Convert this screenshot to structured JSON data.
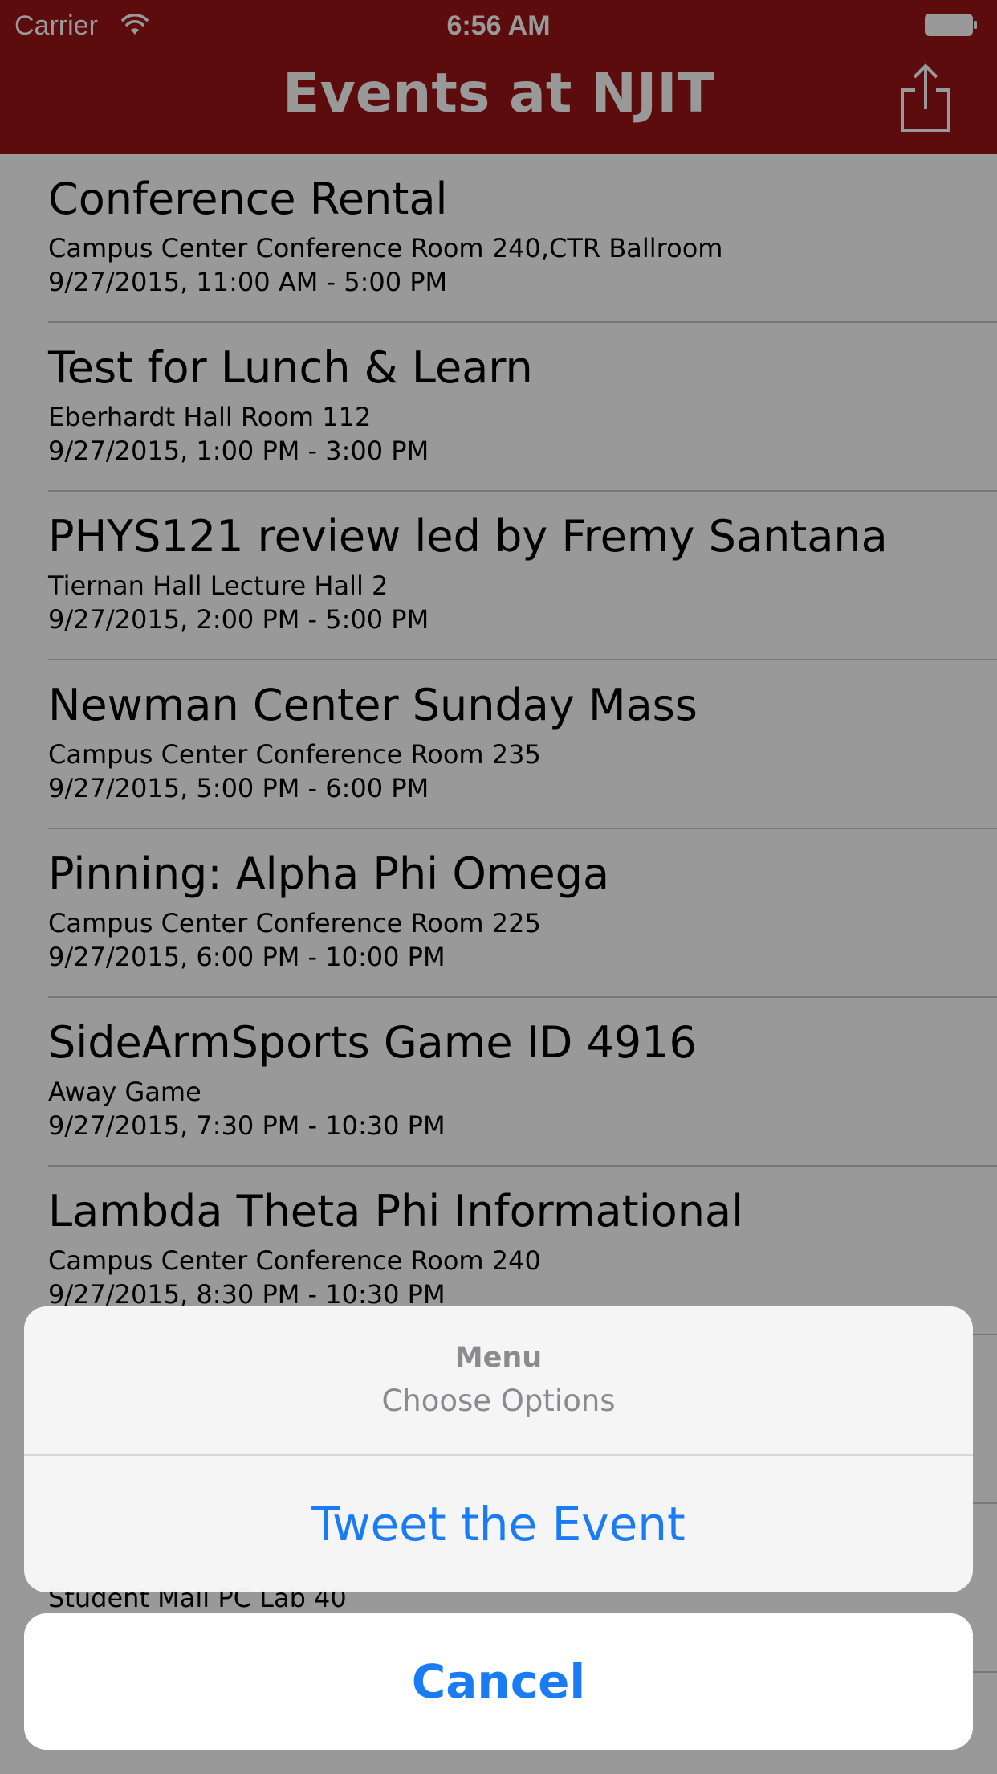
{
  "status_bar": {
    "carrier": "Carrier",
    "time": "6:56 AM"
  },
  "nav": {
    "title": "Events at NJIT",
    "share_icon": "share-icon"
  },
  "events": [
    {
      "title": "Conference Rental",
      "location": "Campus Center Conference Room 240,CTR Ballroom",
      "time": "9/27/2015, 11:00 AM - 5:00 PM"
    },
    {
      "title": "Test for Lunch & Learn",
      "location": "Eberhardt Hall Room 112",
      "time": "9/27/2015, 1:00 PM - 3:00 PM"
    },
    {
      "title": "PHYS121 review led by Fremy Santana",
      "location": "Tiernan Hall Lecture Hall 2",
      "time": "9/27/2015, 2:00 PM - 5:00 PM"
    },
    {
      "title": "Newman Center Sunday Mass",
      "location": "Campus Center Conference Room 235",
      "time": "9/27/2015, 5:00 PM - 6:00 PM"
    },
    {
      "title": "Pinning: Alpha Phi Omega",
      "location": "Campus Center Conference Room 225",
      "time": "9/27/2015, 6:00 PM - 10:00 PM"
    },
    {
      "title": "SideArmSports Game ID 4916",
      "location": "Away Game",
      "time": "9/27/2015, 7:30 PM - 10:30 PM"
    },
    {
      "title": "Lambda Theta Phi Informational",
      "location": "Campus Center Conference Room 240",
      "time": "9/27/2015, 8:30 PM - 10:30 PM"
    },
    {
      "title": "",
      "location": "",
      "time": ""
    },
    {
      "title": "",
      "location": "Student Mall PC Lab 40",
      "time": ""
    }
  ],
  "action_sheet": {
    "title": "Menu",
    "message": "Choose Options",
    "tweet_label": "Tweet the Event",
    "cancel_label": "Cancel"
  },
  "colors": {
    "nav_background": "#9b1418",
    "action_blue": "#1a7cf5"
  }
}
